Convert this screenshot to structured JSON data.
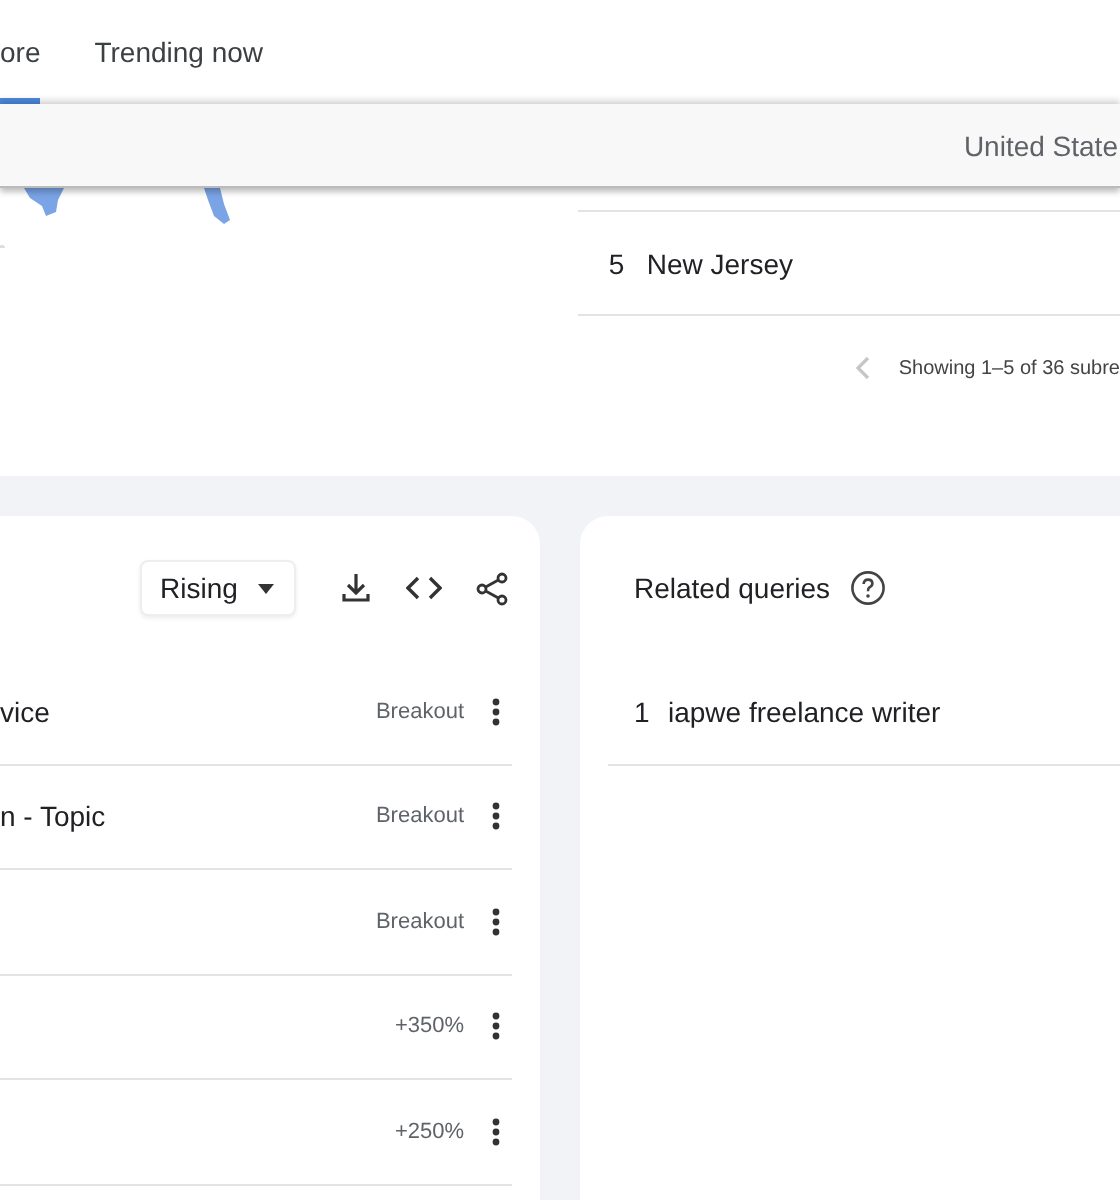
{
  "tabs": [
    {
      "label": "ore",
      "selected": true
    },
    {
      "label": "Trending now",
      "selected": false
    }
  ],
  "location_bar": {
    "text": "United State"
  },
  "regions": {
    "rows": [
      {
        "rank": "5",
        "name": "New Jersey"
      }
    ],
    "pagination": "Showing 1–5 of 36 subre"
  },
  "related_topics": {
    "filter": "Rising",
    "rows": [
      {
        "label": "vice",
        "value": "Breakout"
      },
      {
        "label": "n - Topic",
        "value": "Breakout"
      },
      {
        "label": "",
        "value": "Breakout"
      },
      {
        "label": "",
        "value": "+350%"
      },
      {
        "label": "",
        "value": "+250%"
      }
    ]
  },
  "related_queries": {
    "title": "Related queries",
    "rows": [
      {
        "rank": "1",
        "query": "iapwe freelance writer"
      }
    ]
  }
}
